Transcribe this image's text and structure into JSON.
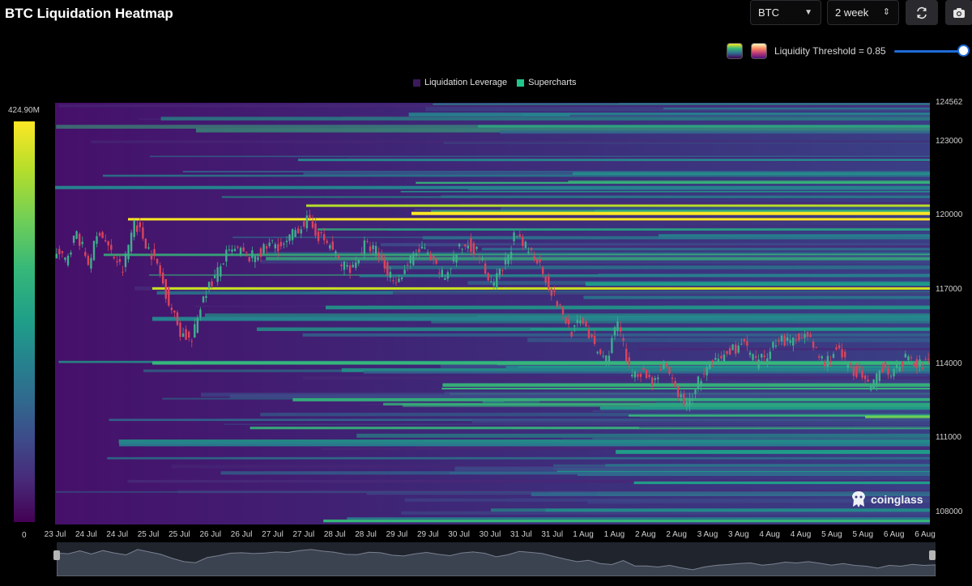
{
  "header": {
    "title": "BTC Liquidation Heatmap",
    "symbol_select": "BTC",
    "range_select": "2 week",
    "refresh_icon": "refresh-icon",
    "camera_icon": "camera-icon"
  },
  "controls": {
    "threshold_label": "Liquidity Threshold = 0.85",
    "threshold_value": 0.85,
    "palette_viridis": "viridis-swatch",
    "palette_magma": "magma-swatch"
  },
  "legend": {
    "items": [
      {
        "label": "Liquidation Leverage",
        "color": "#3b1a5a"
      },
      {
        "label": "Supercharts",
        "color": "#22c58b"
      }
    ]
  },
  "colorbar": {
    "max_label": "424.90M",
    "min_label": "0"
  },
  "watermark": "coinglass",
  "chart_data": {
    "type": "heatmap",
    "title": "BTC Liquidation Heatmap",
    "ylim": [
      107500,
      124562
    ],
    "y_ticks": [
      "124562",
      "123000",
      "120000",
      "117000",
      "114000",
      "111000",
      "108000"
    ],
    "x_ticks": [
      "23 Jul",
      "24 Jul",
      "24 Jul",
      "25 Jul",
      "25 Jul",
      "26 Jul",
      "26 Jul",
      "27 Jul",
      "27 Jul",
      "28 Jul",
      "28 Jul",
      "29 Jul",
      "29 Jul",
      "30 Jul",
      "30 Jul",
      "31 Jul",
      "31 Jul",
      "1 Aug",
      "1 Aug",
      "2 Aug",
      "2 Aug",
      "3 Aug",
      "3 Aug",
      "4 Aug",
      "4 Aug",
      "5 Aug",
      "5 Aug",
      "6 Aug",
      "6 Aug"
    ],
    "colorscale": {
      "min": 0,
      "max": "424.90M"
    },
    "price_series": [
      118500,
      118200,
      119300,
      118100,
      119400,
      118500,
      117800,
      119800,
      118900,
      118000,
      116500,
      115300,
      114900,
      116800,
      117500,
      118400,
      118600,
      118300,
      118500,
      118900,
      118700,
      119400,
      119800,
      119200,
      118800,
      118000,
      117900,
      118800,
      118600,
      117700,
      117400,
      118200,
      118700,
      118000,
      117500,
      118500,
      118900,
      118400,
      117100,
      117800,
      119100,
      118700,
      118300,
      117200,
      116200,
      115300,
      115800,
      114600,
      114200,
      115700,
      113700,
      113700,
      113300,
      113900,
      113000,
      112300,
      113300,
      113900,
      114200,
      114600,
      114800,
      114000,
      114400,
      115100,
      114800,
      115300,
      114700,
      114000,
      114600,
      113900,
      113600,
      112900,
      113900,
      113600,
      114300,
      113900,
      114100
    ]
  }
}
